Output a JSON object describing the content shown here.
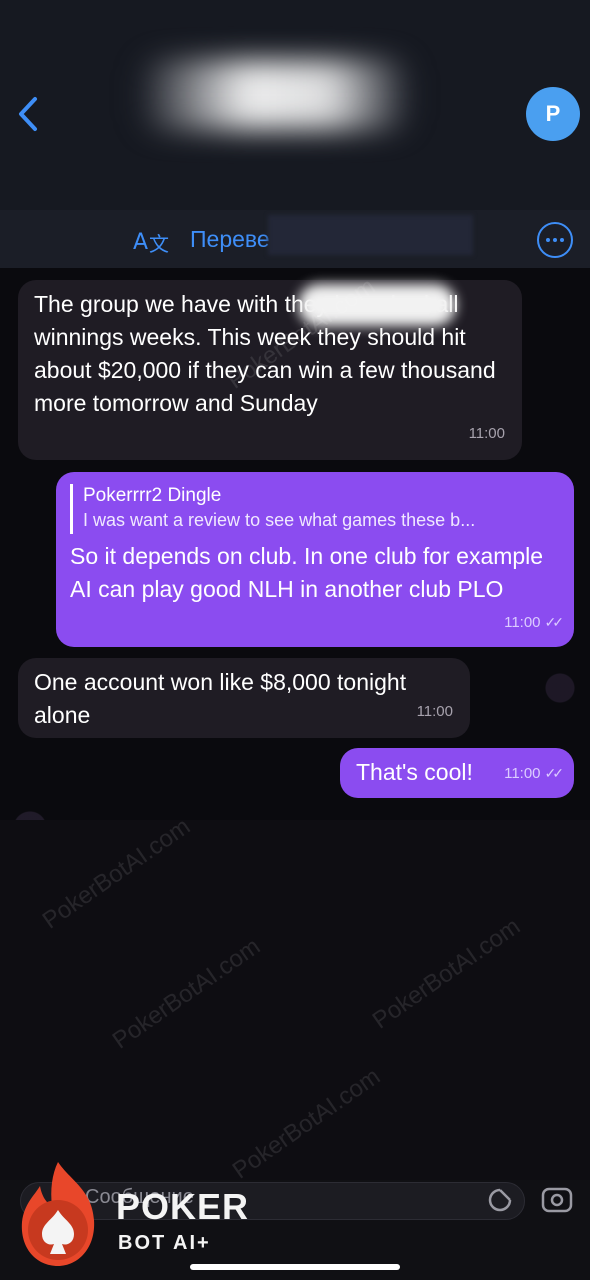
{
  "header": {
    "back_label": "",
    "avatar_letter": "P",
    "translate_label": "Переве"
  },
  "messages": [
    {
      "type": "incoming",
      "text": "The group we have with                         they have had all winnings weeks. This week they should hit about $20,000 if they can win a few thousand more tomorrow and Sunday",
      "time": "11:00"
    },
    {
      "type": "outgoing",
      "reply_name": "Pokerrrr2 Dingle",
      "reply_quote": "I was want a review to see what games these b...",
      "text": "So it depends on club. In one club for example AI can play good NLH in another club PLO",
      "time": "11:00"
    },
    {
      "type": "incoming",
      "text": "One account won like $8,000 tonight alone",
      "time": "11:00"
    },
    {
      "type": "outgoing",
      "text": "That's cool!",
      "time": "11:00"
    }
  ],
  "composer": {
    "placeholder": "Сообщение"
  },
  "brand": {
    "line1": "POKER",
    "line2": "BOT AI+",
    "watermark": "PokerBotAI.com"
  },
  "colors": {
    "accent": "#3e8ef7",
    "outgoing_bubble": "#8b4cf0",
    "incoming_bubble": "#1f1c24"
  }
}
